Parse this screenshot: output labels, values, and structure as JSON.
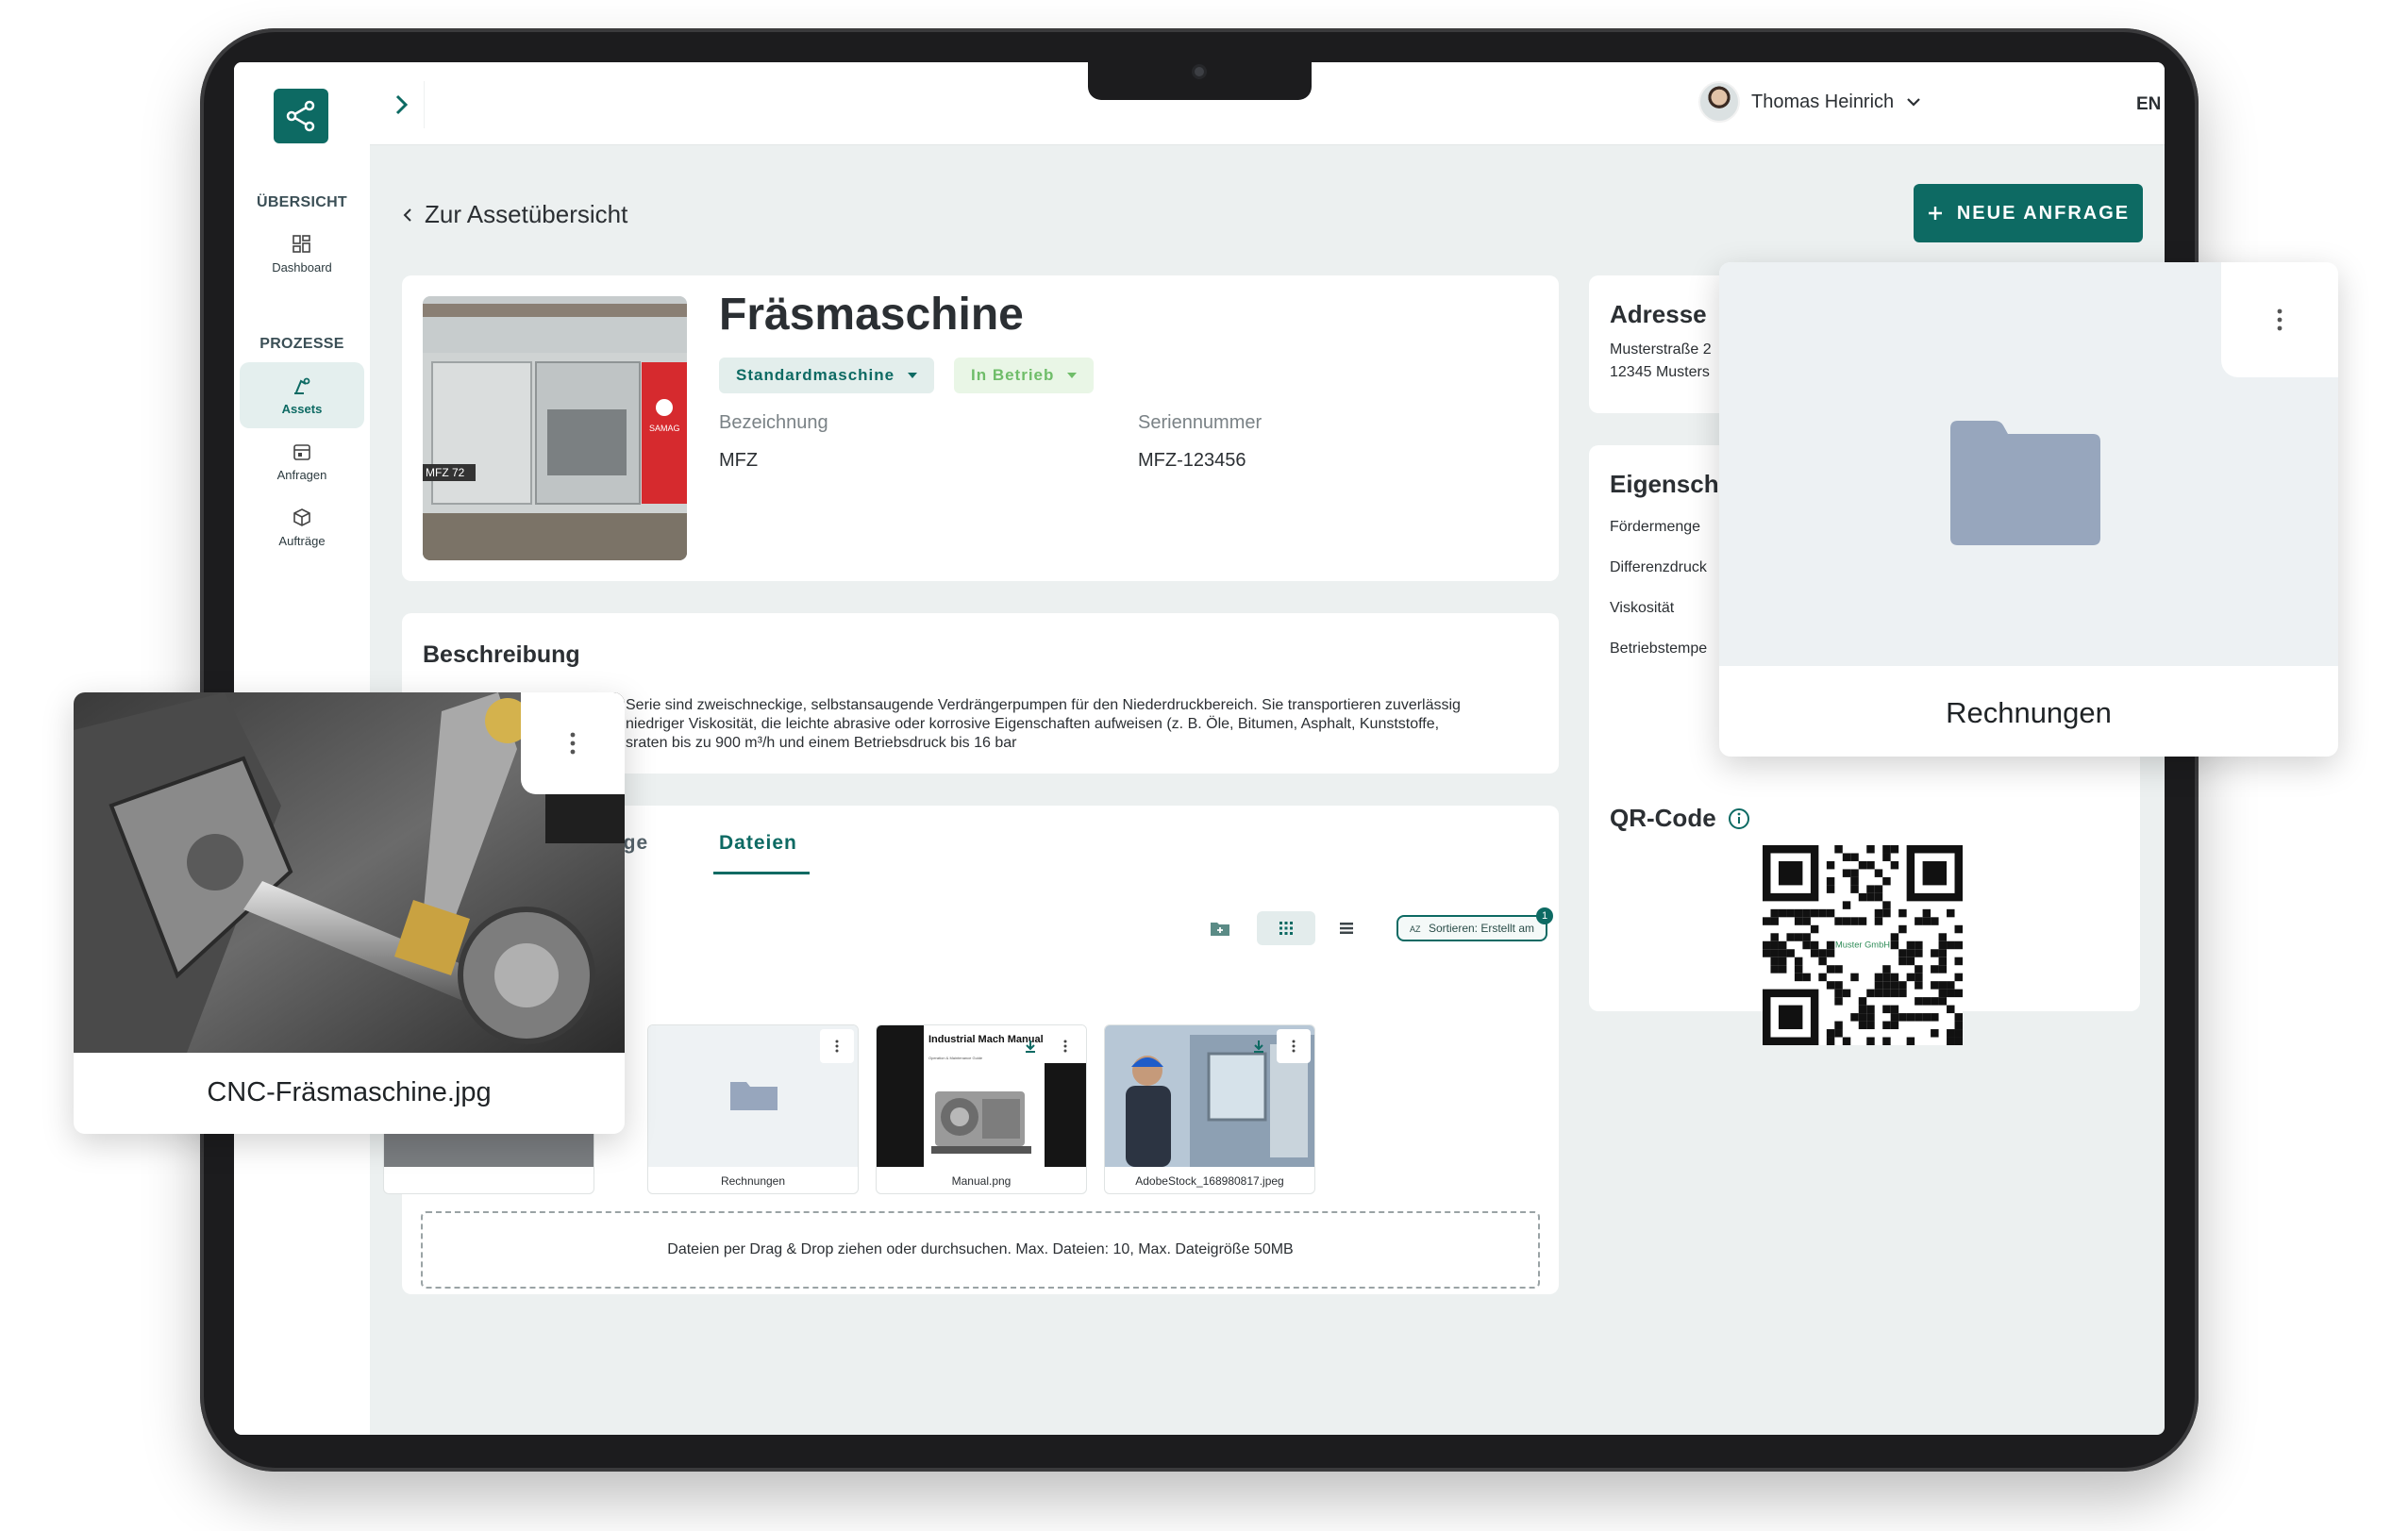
{
  "topbar": {
    "user_name": "Thomas Heinrich",
    "language": "EN"
  },
  "sidebar": {
    "section_overview": "ÜBERSICHT",
    "section_processes": "PROZESSE",
    "items": [
      {
        "label": "Dashboard",
        "icon": "dashboard-icon"
      },
      {
        "label": "Assets",
        "icon": "assets-icon",
        "active": true
      },
      {
        "label": "Anfragen",
        "icon": "calendar-icon"
      },
      {
        "label": "Aufträge",
        "icon": "box-icon"
      }
    ]
  },
  "page": {
    "back_link": "Zur Assetübersicht",
    "new_request_button": "NEUE ANFRAGE"
  },
  "asset": {
    "image_label": "MFZ 72",
    "brand_label": "SAMAG",
    "title": "Fräsmaschine",
    "type_chip": "Standardmaschine",
    "status_chip": "In Betrieb",
    "fields": [
      {
        "label": "Bezeichnung",
        "value": "MFZ"
      },
      {
        "label": "Seriennummer",
        "value": "MFZ-123456"
      }
    ]
  },
  "description": {
    "title": "Beschreibung",
    "lines": [
      "Serie sind zweischneckige, selbstansaugende Verdrängerpumpen für den Niederdruckbereich. Sie transportieren zuverlässig",
      "niedriger Viskosität, die leichte abrasive oder korrosive Eigenschaften aufweisen (z. B. Öle, Bitumen, Asphalt, Kunststoffe,",
      "sraten bis zu 900 m³/h und einem Betriebsdruck bis 16 bar"
    ]
  },
  "files": {
    "tabs": [
      "äge",
      "Dateien"
    ],
    "sort_label": "Sortieren: Erstellt am",
    "sort_badge": "1",
    "tiles": [
      {
        "name": "Rechnungen",
        "kind": "folder"
      },
      {
        "name": "Manual.png",
        "kind": "image",
        "thumb_title": "Industrial Mach Manual",
        "thumb_subtitle": "Operation & Maintenance Guide"
      },
      {
        "name": "AdobeStock_168980817.jpeg",
        "kind": "image"
      }
    ],
    "dropzone_text": "Dateien per Drag & Drop ziehen oder durchsuchen. Max. Dateien: 10, Max. Dateigröße 50MB"
  },
  "address": {
    "title": "Adresse",
    "line1": "Musterstraße 2",
    "line2": "12345 Musters"
  },
  "properties": {
    "title": "Eigenscha",
    "items": [
      "Fördermenge",
      "Differenzdruck",
      "Viskosität",
      "Betriebstempe"
    ]
  },
  "qr": {
    "title": "QR-Code",
    "center_label": "Muster GmbH"
  },
  "floating": {
    "folder_caption": "Rechnungen",
    "image_caption": "CNC-Fräsmaschine.jpg"
  },
  "colors": {
    "primary": "#0d6a63",
    "status_green": "#6fbd69",
    "sun": "#f5b400",
    "folder": "#97a6bd"
  }
}
